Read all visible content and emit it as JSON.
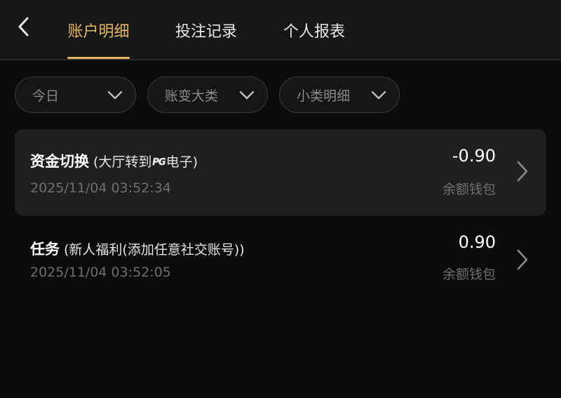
{
  "header": {
    "tabs": [
      {
        "label": "账户明细",
        "active": true
      },
      {
        "label": "投注记录",
        "active": false
      },
      {
        "label": "个人报表",
        "active": false
      }
    ]
  },
  "filters": [
    {
      "label": "今日"
    },
    {
      "label": "账变大类"
    },
    {
      "label": "小类明细"
    }
  ],
  "records": [
    {
      "title": "资金切换",
      "detail_before": "(大厅转到",
      "detail_logo": "PG",
      "detail_after": "电子)",
      "time": "2025/11/04 03:52:34",
      "amount": "-0.90",
      "wallet": "余额钱包"
    },
    {
      "title": "任务",
      "detail": "(新人福利(添加任意社交账号))",
      "time": "2025/11/04 03:52:05",
      "amount": "0.90",
      "wallet": "余额钱包"
    }
  ],
  "colors": {
    "accent": "#e3b85e",
    "background": "#0b0b0b",
    "muted_text": "#6f6f6f"
  },
  "icons": {
    "back": "chevron-left-icon",
    "dropdown": "chevron-down-icon",
    "row_arrow": "chevron-right-icon"
  }
}
